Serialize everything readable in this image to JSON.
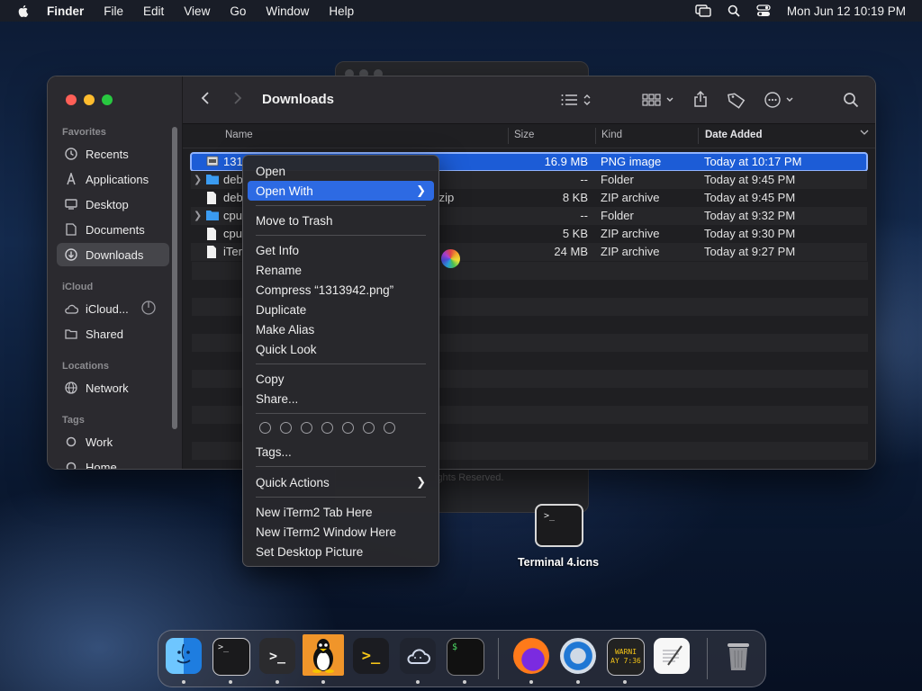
{
  "menubar": {
    "app": "Finder",
    "items": [
      "File",
      "Edit",
      "View",
      "Go",
      "Window",
      "Help"
    ],
    "datetime": "Mon Jun 12  10:19 PM"
  },
  "sidebar": {
    "favorites_title": "Favorites",
    "favorites": [
      "Recents",
      "Applications",
      "Desktop",
      "Documents",
      "Downloads"
    ],
    "icloud_title": "iCloud",
    "icloud": [
      "iCloud...",
      "Shared"
    ],
    "locations_title": "Locations",
    "locations": [
      "Network"
    ],
    "tags_title": "Tags",
    "tags": [
      "Work",
      "Home"
    ]
  },
  "toolbar": {
    "title": "Downloads"
  },
  "columns": {
    "name": "Name",
    "size": "Size",
    "kind": "Kind",
    "date": "Date Added"
  },
  "files": [
    {
      "name": "131",
      "size": "16.9 MB",
      "kind": "PNG image",
      "date": "Today at 10:17 PM"
    },
    {
      "name": "deb",
      "size": "--",
      "kind": "Folder",
      "date": "Today at 9:45 PM"
    },
    {
      "name": "deb",
      "suffix": ".zip",
      "size": "8 KB",
      "kind": "ZIP archive",
      "date": "Today at 9:45 PM"
    },
    {
      "name": "cpu",
      "size": "--",
      "kind": "Folder",
      "date": "Today at 9:32 PM"
    },
    {
      "name": "cpu",
      "size": "5 KB",
      "kind": "ZIP archive",
      "date": "Today at 9:30 PM"
    },
    {
      "name": "iTer",
      "size": "24 MB",
      "kind": "ZIP archive",
      "date": "Today at 9:27 PM"
    }
  ],
  "background_window": {
    "copyright": "ights Reserved."
  },
  "context_menu": {
    "open": "Open",
    "open_with": "Open With",
    "move_to_trash": "Move to Trash",
    "get_info": "Get Info",
    "rename": "Rename",
    "compress": "Compress “1313942.png”",
    "duplicate": "Duplicate",
    "make_alias": "Make Alias",
    "quick_look": "Quick Look",
    "copy": "Copy",
    "share": "Share...",
    "tags": "Tags...",
    "quick_actions": "Quick Actions",
    "new_iterm_tab": "New iTerm2 Tab Here",
    "new_iterm_window": "New iTerm2 Window Here",
    "set_desktop_picture": "Set Desktop Picture"
  },
  "desktop": {
    "icon_label": "Terminal 4.icns",
    "icon_prompt": ">_"
  },
  "dock": {
    "console_text": "WARNI\nAY 7:36",
    "apps": [
      "finder-icon",
      "terminal-icon",
      "terminal-dark-icon",
      "tux-icon",
      "powershell-icon",
      "cloud-icon",
      "iterm-icon",
      "firefox-icon",
      "quicktime-icon",
      "console-icon",
      "textedit-icon",
      "trash-icon"
    ]
  },
  "colors": {
    "selection": "#1c5cd6",
    "menu_highlight": "#2d6ae3",
    "folder": "#3b9cf2"
  }
}
